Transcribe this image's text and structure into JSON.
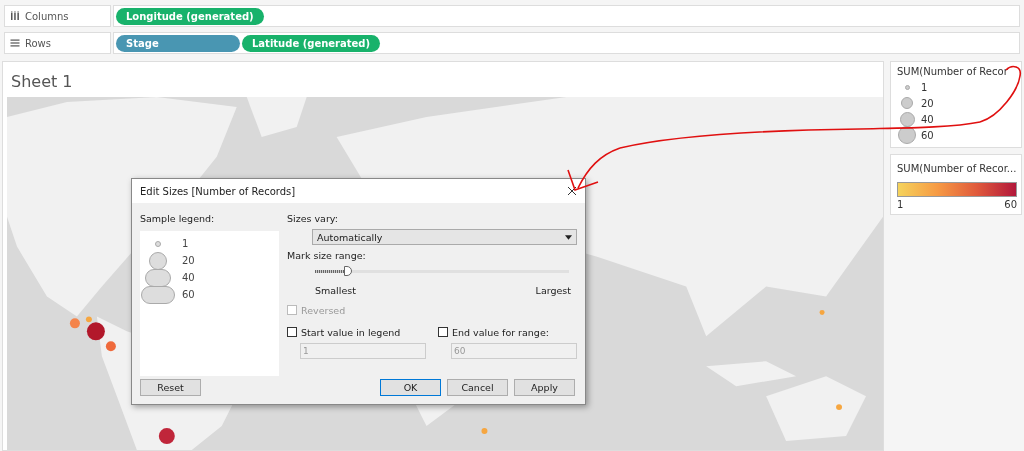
{
  "shelves": [
    {
      "kind": "columns",
      "label": "Columns",
      "pills": [
        {
          "text": "Longitude (generated)",
          "kind": "measure"
        }
      ]
    },
    {
      "kind": "rows",
      "label": "Rows",
      "pills": [
        {
          "text": "Stage",
          "kind": "dimension"
        },
        {
          "text": "Latitude (generated)",
          "kind": "measure"
        }
      ]
    }
  ],
  "sheet": {
    "title": "Sheet 1"
  },
  "size_legend": {
    "title": "SUM(Number of Recor",
    "items": [
      "1",
      "20",
      "40",
      "60"
    ]
  },
  "color_legend": {
    "title": "SUM(Number of Recor...",
    "min": "1",
    "max": "60"
  },
  "dialog": {
    "title": "Edit Sizes [Number of Records]",
    "sample_label": "Sample legend:",
    "sample_items": [
      "1",
      "20",
      "40",
      "60"
    ],
    "sizes_vary_label": "Sizes vary:",
    "sizes_vary_value": "Automatically",
    "mark_size_label": "Mark size range:",
    "slider": {
      "level": 0.13
    },
    "smallest": "Smallest",
    "largest": "Largest",
    "reversed": {
      "label": "Reversed",
      "checked": false,
      "disabled": true
    },
    "start": {
      "label": "Start value in legend",
      "checked": false,
      "value": "1"
    },
    "end": {
      "label": "End value for range:",
      "checked": false,
      "value": "60"
    },
    "buttons": [
      {
        "label": "Reset",
        "default": false
      },
      {
        "label": "OK",
        "default": true
      },
      {
        "label": "Cancel",
        "default": false
      },
      {
        "label": "Apply",
        "default": false
      }
    ]
  }
}
